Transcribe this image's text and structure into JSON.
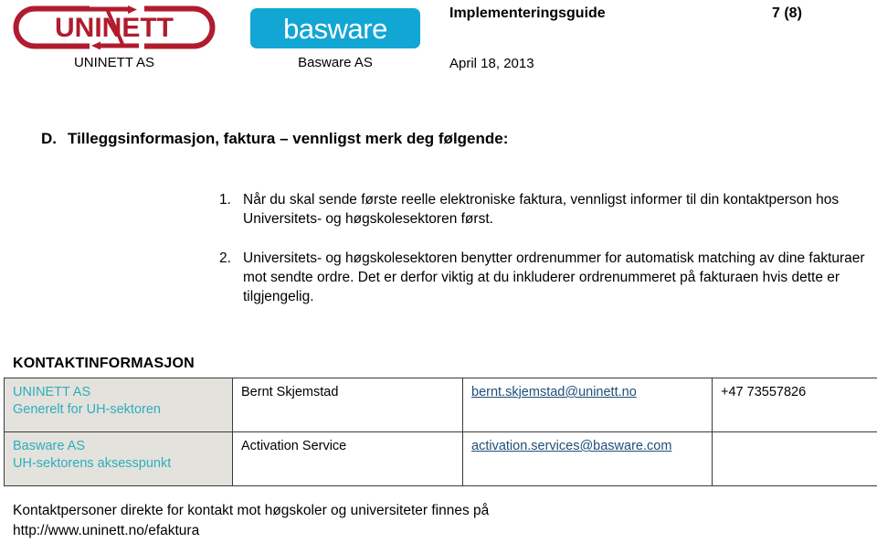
{
  "header": {
    "uninett_logo_text": "UNINETT",
    "uninett_caption": "UNINETT AS",
    "basware_logo_text": "basware",
    "basware_caption": "Basware AS",
    "document_title": "Implementeringsguide",
    "page_number": "7 (8)",
    "date": "April 18, 2013",
    "colors": {
      "uninett_red": "#B01C2E",
      "basware_cyan": "#12A6D4"
    }
  },
  "section": {
    "letter": "D.",
    "heading": "Tilleggsinformasjon, faktura – vennligst merk deg følgende:",
    "items": [
      {
        "marker": "1.",
        "text": "Når du skal sende første reelle elektroniske faktura, vennligst informer til din kontaktperson hos Universitets- og høgskolesektoren først."
      },
      {
        "marker": "2.",
        "text": "Universitets- og høgskolesektoren benytter ordrenummer for automatisk matching av dine fakturaer mot sendte ordre. Det er derfor viktig at du inkluderer ordrenummeret på fakturaen hvis dette er tilgjengelig."
      }
    ]
  },
  "contact": {
    "title": "KONTAKTINFORMASJON",
    "org_label_color": "#2FAEBC",
    "link_color": "#1F4E79",
    "rows": [
      {
        "org_name": "UNINETT AS",
        "org_role": "Generelt for UH-sektoren",
        "contact_name": "Bernt Skjemstad",
        "email": "bernt.skjemstad@uninett.no",
        "phone": "+47 73557826"
      },
      {
        "org_name": "Basware AS",
        "org_role": "UH-sektorens aksesspunkt",
        "contact_name": "Activation Service",
        "email": "activation.services@basware.com",
        "phone": ""
      }
    ]
  },
  "footer": {
    "line1": "Kontaktpersoner direkte for kontakt mot høgskoler og universiteter finnes på",
    "line2": "http://www.uninett.no/efaktura"
  }
}
